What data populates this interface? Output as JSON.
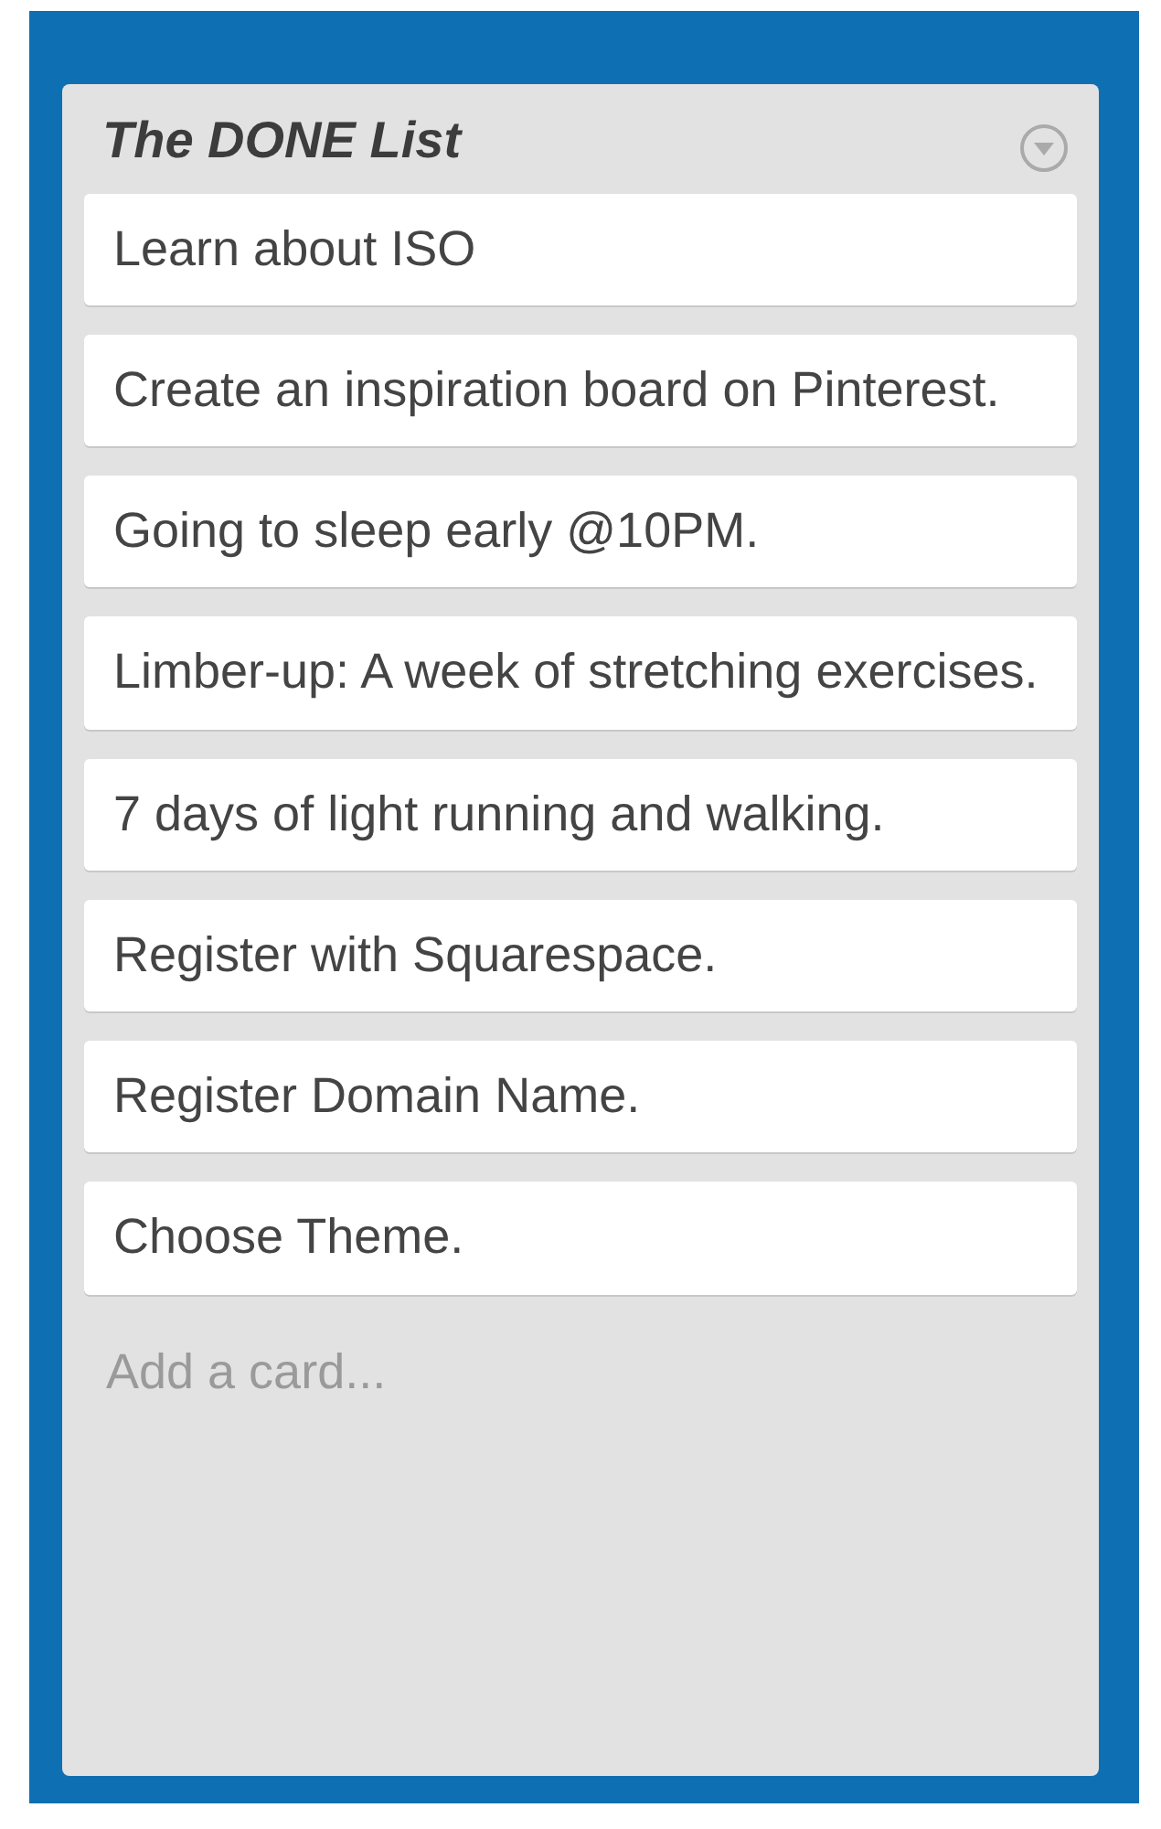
{
  "list": {
    "title": "The DONE List",
    "cards": [
      {
        "text": "Learn about ISO"
      },
      {
        "text": "Create an inspiration board on Pinterest."
      },
      {
        "text": "Going to sleep early @10PM."
      },
      {
        "text": "Limber-up: A week of stretching exercises."
      },
      {
        "text": "7 days of light running and walking."
      },
      {
        "text": "Register with Squarespace."
      },
      {
        "text": "Register Domain Name."
      },
      {
        "text": "Choose Theme."
      }
    ],
    "add_card": "Add a card..."
  }
}
